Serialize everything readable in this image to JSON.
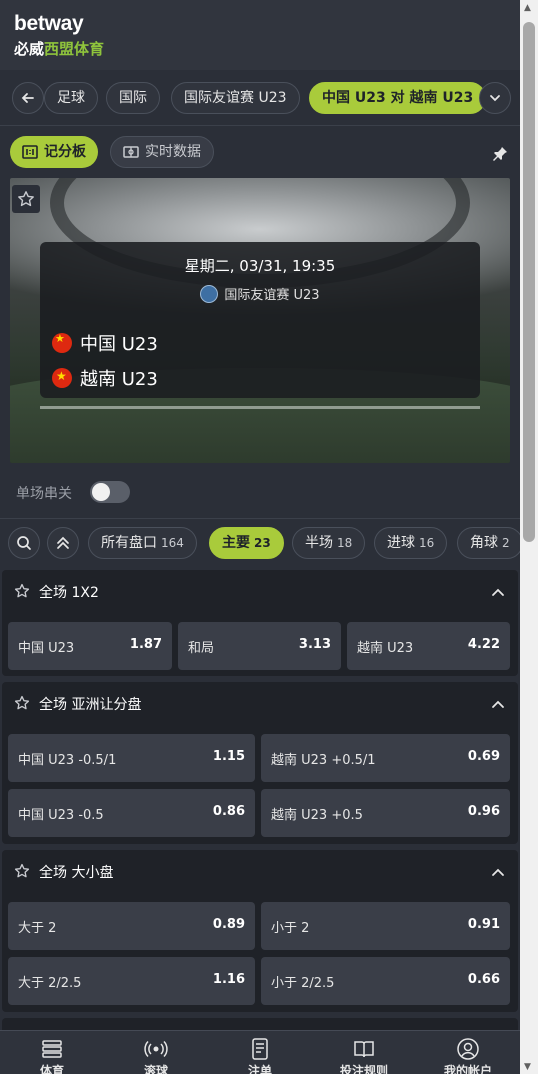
{
  "brand": {
    "name": "betway",
    "sub_a": "必威",
    "sub_b": "西盟体育"
  },
  "breadcrumb": {
    "back_icon": "arrow-left-icon",
    "items": [
      "足球",
      "国际",
      "国际友谊赛 U23",
      "中国 U23 对 越南 U23"
    ],
    "more_icon": "chevron-down-icon"
  },
  "scoreboard_tabs": {
    "scoreboard": "记分板",
    "live_data": "实时数据"
  },
  "match": {
    "datetime": "星期二, 03/31, 19:35",
    "competition": "国际友谊赛 U23",
    "home": "中国 U23",
    "away": "越南 U23"
  },
  "parlay": {
    "label": "单场串关",
    "enabled": false
  },
  "filters": [
    {
      "label": "所有盘口",
      "count": "164"
    },
    {
      "label": "主要",
      "count": "23"
    },
    {
      "label": "半场",
      "count": "18"
    },
    {
      "label": "进球",
      "count": "16"
    },
    {
      "label": "角球",
      "count": "2"
    }
  ],
  "markets": [
    {
      "title": "全场 1X2",
      "odds": [
        {
          "label": "中国 U23",
          "value": "1.87"
        },
        {
          "label": "和局",
          "value": "3.13"
        },
        {
          "label": "越南 U23",
          "value": "4.22"
        }
      ]
    },
    {
      "title": "全场 亚洲让分盘",
      "odds": [
        {
          "label": "中国 U23  -0.5/1",
          "value": "1.15"
        },
        {
          "label": "越南 U23  +0.5/1",
          "value": "0.69"
        },
        {
          "label": "中国 U23  -0.5",
          "value": "0.86"
        },
        {
          "label": "越南 U23  +0.5",
          "value": "0.96"
        }
      ]
    },
    {
      "title": "全场 大小盘",
      "odds": [
        {
          "label": "大于 2",
          "value": "0.89"
        },
        {
          "label": "小于 2",
          "value": "0.91"
        },
        {
          "label": "大于 2/2.5",
          "value": "1.16"
        },
        {
          "label": "小于 2/2.5",
          "value": "0.66"
        }
      ]
    }
  ],
  "bottom_nav": [
    {
      "label": "体育",
      "icon": "sports-list-icon"
    },
    {
      "label": "滚球",
      "icon": "live-broadcast-icon"
    },
    {
      "label": "注单",
      "icon": "bet-slip-icon"
    },
    {
      "label": "投注规则",
      "icon": "rules-book-icon"
    },
    {
      "label": "我的帐户",
      "icon": "account-icon"
    }
  ],
  "colors": {
    "accent": "#a9cb3b",
    "background": "#2b2f38",
    "odds_cell": "#3a3e48"
  }
}
